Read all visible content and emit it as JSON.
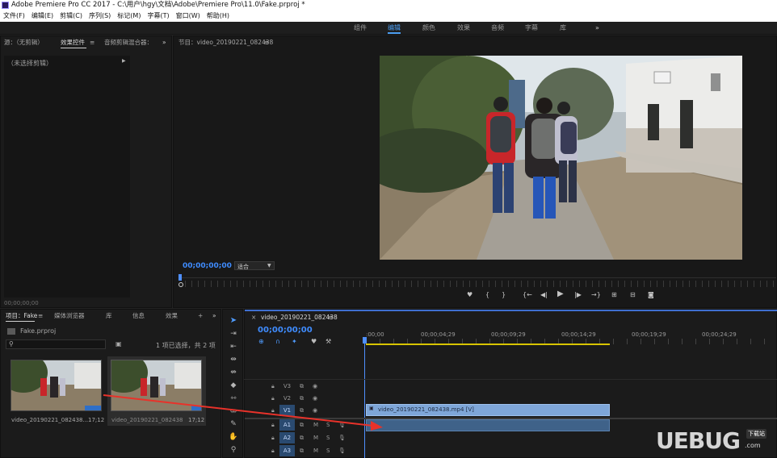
{
  "title_bar": {
    "text": "Adobe Premiere Pro CC 2017 - C:\\用户\\hgy\\文档\\Adobe\\Premiere Pro\\11.0\\Fake.prproj *"
  },
  "menu": [
    "文件(F)",
    "编辑(E)",
    "剪辑(C)",
    "序列(S)",
    "标记(M)",
    "字幕(T)",
    "窗口(W)",
    "帮助(H)"
  ],
  "workspaces": {
    "items": [
      "组件",
      "编辑",
      "颜色",
      "效果",
      "音频",
      "字幕",
      "库"
    ],
    "active": "编辑",
    "more": "»"
  },
  "source_panel": {
    "tabs": [
      "源：（无剪辑）",
      "效果控件",
      "音频剪辑混合器："
    ],
    "menu_glyph": "≡",
    "more": "»",
    "no_clip": "（未选择剪辑）",
    "timecode": "00;00;00;00"
  },
  "program_panel": {
    "title": "节目：video_20190221_082438",
    "menu_glyph": "≡",
    "timecode": "00;00;00;00",
    "zoom": "适合"
  },
  "project_panel": {
    "tabs": [
      "项目：Fake",
      "媒体浏览器",
      "库",
      "信息",
      "效果",
      "+"
    ],
    "more": "»",
    "file": "Fake.prproj",
    "selection_info": "1 项已选择，共 2 项",
    "items": [
      {
        "name": "video_20190221_082438...",
        "duration": "17;12"
      },
      {
        "name": "video_20190221_082438",
        "duration": "17;12"
      }
    ]
  },
  "timeline": {
    "close": "×",
    "sequence": "video_20190221_082438",
    "menu_glyph": "≡",
    "timecode": "00;00;00;00",
    "ruler": [
      ":00;00",
      "00;00;04;29",
      "00;00;09;29",
      "00;00;14;29",
      "00;00;19;29",
      "00;00;24;29"
    ],
    "tracks": [
      {
        "label": "V3",
        "m": "",
        "s": ""
      },
      {
        "label": "V2",
        "m": "",
        "s": ""
      },
      {
        "label": "V1",
        "m": "",
        "s": ""
      },
      {
        "label": "A1",
        "m": "M",
        "s": "S"
      },
      {
        "label": "A2",
        "m": "M",
        "s": "S"
      },
      {
        "label": "A3",
        "m": "M",
        "s": "S"
      }
    ],
    "clip": {
      "label": "video_20190221_082438.mp4 [V]"
    }
  },
  "watermark": {
    "main": "UEBUG",
    "dot": ".com",
    "badge": "下载站"
  },
  "colors": {
    "accent": "#3f8cff",
    "clip_video": "#7ea6d8",
    "clip_audio": "#3f6289",
    "arrow": "#e8322a",
    "cti": "#4f8fff"
  },
  "icons": [
    "play-icon",
    "step-back-icon",
    "step-forward-icon",
    "marker-icon",
    "camera-icon",
    "selection-tool-icon",
    "razor-tool-icon",
    "pen-tool-icon",
    "hand-tool-icon",
    "lock-icon",
    "eye-icon",
    "mic-icon"
  ]
}
